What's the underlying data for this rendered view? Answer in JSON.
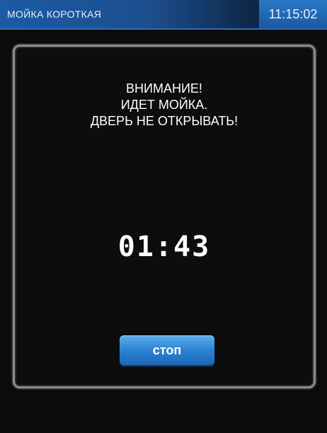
{
  "header": {
    "title": "МОЙКА КОРОТКАЯ",
    "time": "11:15:02"
  },
  "main": {
    "warning_lines": [
      "ВНИМАНИЕ!",
      "ИДЕТ МОЙКА.",
      "ДВЕРЬ НЕ ОТКРЫВАТЬ!"
    ],
    "countdown": "01:43",
    "stop_label": "стоп"
  },
  "colors": {
    "accent": "#2e86d6",
    "background": "#0b0b0b"
  }
}
